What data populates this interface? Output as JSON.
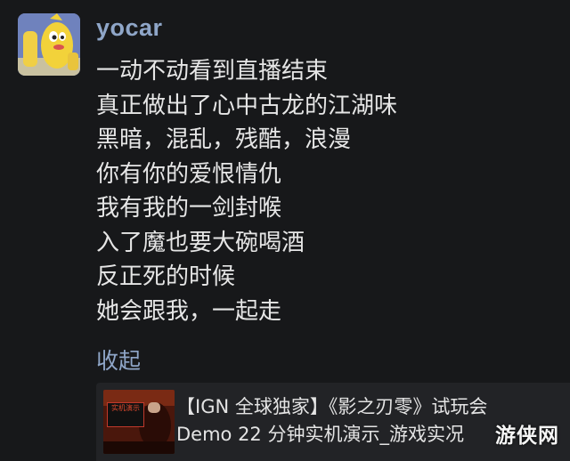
{
  "comment": {
    "username": "yocar",
    "lines": [
      "一动不动看到直播结束",
      "真正做出了心中古龙的江湖味",
      "黑暗，混乱，残酷，浪漫",
      "你有你的爱恨情仇",
      "我有我的一剑封喉",
      "入了魔也要大碗喝酒",
      "反正死的时候",
      "她会跟我，一起走"
    ],
    "collapse_label": "收起"
  },
  "video_card": {
    "title_lines": [
      "【IGN 全球独家】《影之刃零》试玩会",
      "Demo 22 分钟实机演示_游戏实况"
    ],
    "thumbnail_text": "实机演示"
  },
  "watermark": "游侠网"
}
